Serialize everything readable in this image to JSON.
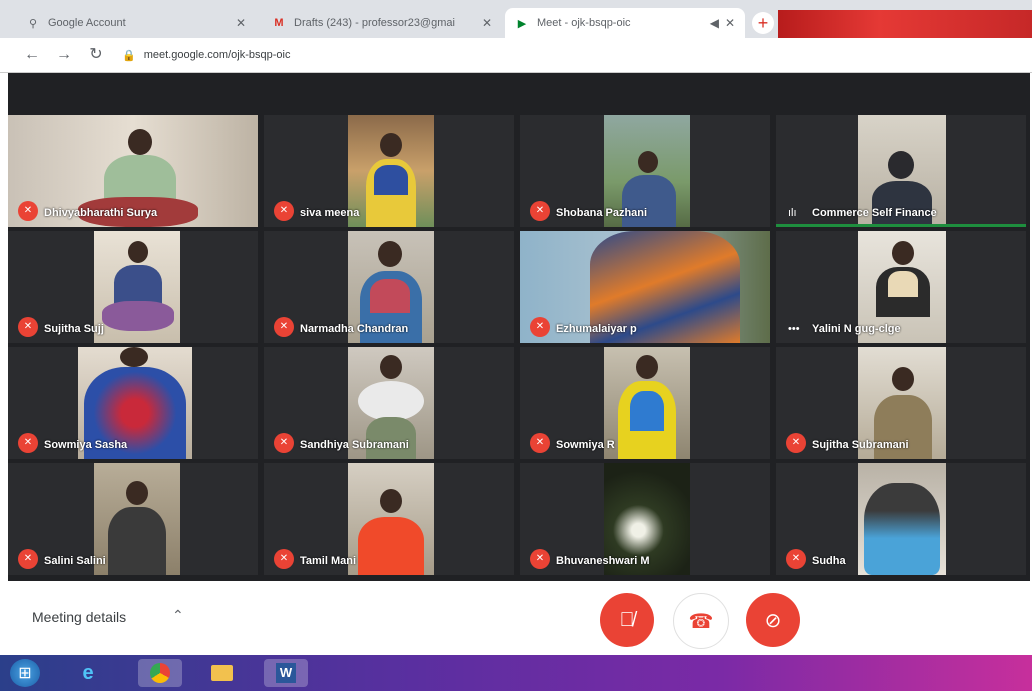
{
  "browser": {
    "tabs": [
      {
        "icon": "search-icon",
        "label": "Google Account",
        "active": false
      },
      {
        "icon": "mail-icon",
        "label": "Drafts (243) - professor23@gmai",
        "active": false
      },
      {
        "icon": "meet-icon",
        "label": "Meet - ojk-bsqp-oic",
        "active": true
      }
    ],
    "url": "meet.google.com/ojk-bsqp-oic"
  },
  "participants": [
    {
      "name": "Dhivyabharathi Surya",
      "indicator": "muted",
      "speaking": false
    },
    {
      "name": "siva meena",
      "indicator": "muted",
      "speaking": false
    },
    {
      "name": "Shobana Pazhani",
      "indicator": "muted",
      "speaking": false
    },
    {
      "name": "Commerce Self Finance",
      "indicator": "active",
      "speaking": true
    },
    {
      "name": "Sujitha Sujj",
      "indicator": "muted",
      "speaking": false
    },
    {
      "name": "Narmadha Chandran",
      "indicator": "muted",
      "speaking": false
    },
    {
      "name": "Ezhumalaiyar p",
      "indicator": "muted",
      "speaking": false
    },
    {
      "name": "Yalini N gug-clge",
      "indicator": "more",
      "speaking": false
    },
    {
      "name": "Sowmiya Sasha",
      "indicator": "muted",
      "speaking": false
    },
    {
      "name": "Sandhiya Subramani",
      "indicator": "muted",
      "speaking": false
    },
    {
      "name": "Sowmiya R",
      "indicator": "muted",
      "speaking": false
    },
    {
      "name": "Sujitha Subramani",
      "indicator": "muted",
      "speaking": false
    },
    {
      "name": "Salini Salini",
      "indicator": "muted",
      "speaking": false
    },
    {
      "name": "Tamil Mani",
      "indicator": "muted",
      "speaking": false
    },
    {
      "name": "Bhuvaneshwari M",
      "indicator": "muted",
      "speaking": false
    },
    {
      "name": "Sudha",
      "indicator": "muted",
      "speaking": false
    }
  ],
  "controls": {
    "meeting_details": "Meeting details",
    "mic_icon": "mic-off-icon",
    "hangup_icon": "hangup-icon",
    "camera_icon": "camera-off-icon"
  },
  "taskbar": [
    {
      "icon": "windows-start-icon"
    },
    {
      "icon": "ie-icon"
    },
    {
      "icon": "chrome-icon"
    },
    {
      "icon": "folder-icon"
    },
    {
      "icon": "word-icon"
    }
  ],
  "colors": {
    "meet_bg": "#202124",
    "accent_red": "#ea4335",
    "speaking_green": "#1e8e3e"
  }
}
